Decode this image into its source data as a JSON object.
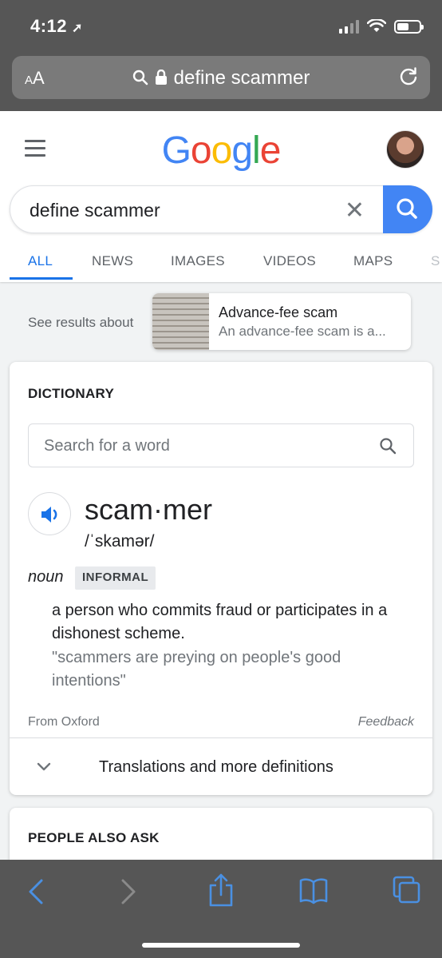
{
  "status_bar": {
    "time": "4:12"
  },
  "browser": {
    "aa_label": "AA",
    "url_text": "define scammer"
  },
  "google": {
    "logo_letters": [
      {
        "ch": "G",
        "color": "#4285f4"
      },
      {
        "ch": "o",
        "color": "#ea4335"
      },
      {
        "ch": "o",
        "color": "#fbbc05"
      },
      {
        "ch": "g",
        "color": "#4285f4"
      },
      {
        "ch": "l",
        "color": "#34a853"
      },
      {
        "ch": "e",
        "color": "#ea4335"
      }
    ],
    "search_query": "define scammer",
    "tabs": [
      "ALL",
      "NEWS",
      "IMAGES",
      "VIDEOS",
      "MAPS",
      "S"
    ],
    "active_tab": "ALL"
  },
  "see_results": {
    "label": "See results about",
    "entity_title": "Advance-fee scam",
    "entity_subtitle": "An advance-fee scam is a..."
  },
  "dictionary": {
    "heading": "DICTIONARY",
    "search_placeholder": "Search for a word",
    "headword": "scam·mer",
    "phonetic": "/ˈskamər/",
    "part_of_speech": "noun",
    "register": "INFORMAL",
    "definition": "a person who commits fraud or participates in a dishonest scheme.",
    "example": "\"scammers are preying on people's good intentions\"",
    "source": "From Oxford",
    "feedback": "Feedback",
    "more_label": "Translations and more definitions"
  },
  "people_also_ask": {
    "heading": "PEOPLE ALSO ASK"
  },
  "colors": {
    "google_blue": "#4285f4",
    "link_blue": "#1a73e8",
    "chrome_gray": "#565656"
  }
}
